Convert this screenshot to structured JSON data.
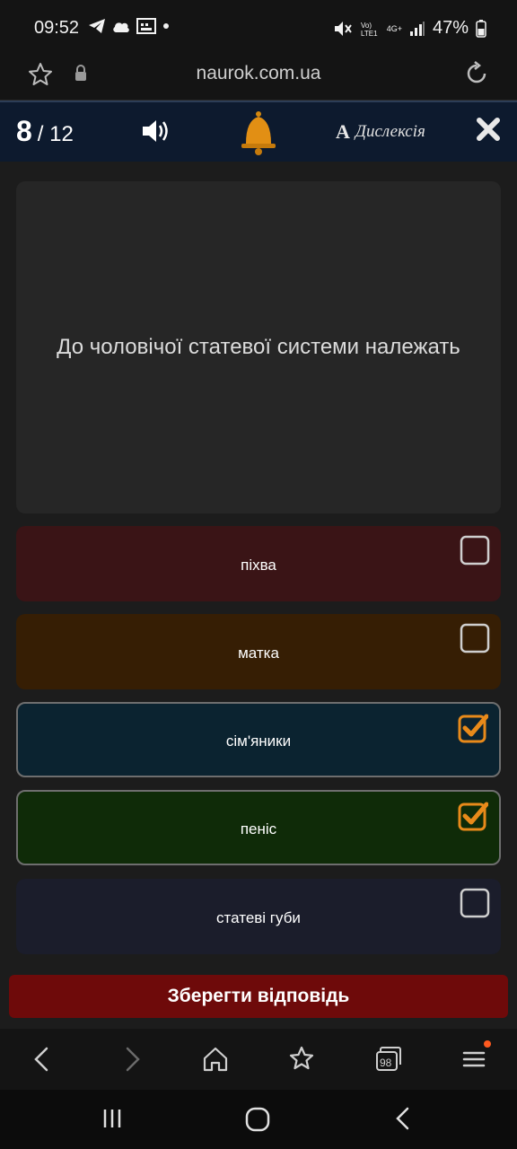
{
  "status_bar": {
    "time": "09:52",
    "battery": "47%",
    "network_label": "4G+"
  },
  "browser": {
    "url": "naurok.com.ua"
  },
  "quiz": {
    "current": "8",
    "total": "/ 12",
    "dyslexia_letter": "A",
    "dyslexia_label": "Дислексія",
    "question": "До чоловічої статевої системи належать",
    "options": [
      {
        "label": "піхва",
        "checked": false,
        "color": "#3a1416"
      },
      {
        "label": "матка",
        "checked": false,
        "color": "#361e04"
      },
      {
        "label": "сім'яники",
        "checked": true,
        "color": "#0b2330"
      },
      {
        "label": "пеніс",
        "checked": true,
        "color": "#0f2b08"
      },
      {
        "label": "статеві губи",
        "checked": false,
        "color": "#1b1d2b"
      }
    ],
    "submit_label": "Зберегти відповідь"
  },
  "browser_nav": {
    "tabs_count": "98"
  },
  "colors": {
    "accent": "#e88a1a",
    "submit": "#6e0a0a",
    "header": "#0d1a2e"
  }
}
